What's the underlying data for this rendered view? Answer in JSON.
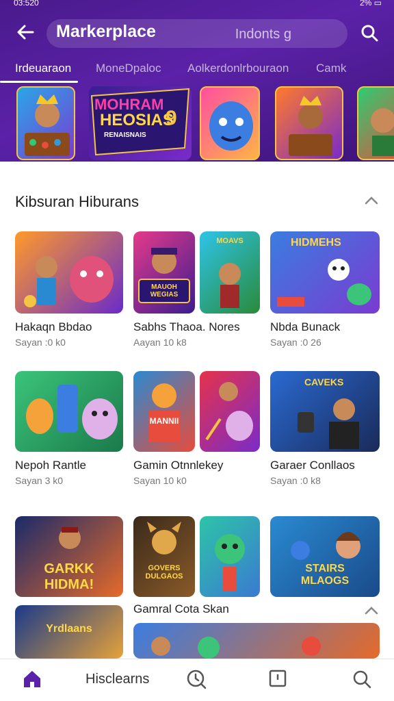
{
  "status_bar": {
    "time": "03:520",
    "battery": "2%"
  },
  "header": {
    "title": "Markerplace",
    "search_text": "Indonts g"
  },
  "tabs": [
    {
      "label": "Irdeuaraon"
    },
    {
      "label": "MoneDpaloc"
    },
    {
      "label": "Aolkerdonlrbouraon"
    },
    {
      "label": "Camk"
    }
  ],
  "banner": {
    "text_line1": "MOHRAM",
    "text_line2": "HEOSIAS",
    "text_line3": "RENAISNAIS",
    "badge": "9"
  },
  "section": {
    "title": "Kibsuran Hiburans"
  },
  "cards": [
    {
      "name": "Hakaqn Bbdao",
      "sub": "Sayan :0 k0"
    },
    {
      "name": "Sabhs Thaoa. Nores",
      "sub": "Aayan 10 k8"
    },
    {
      "name": "Nbda Bunack",
      "sub": "Sayan :0 26"
    },
    {
      "name": "Nepoh Rantle",
      "sub": "Sayan 3 k0"
    },
    {
      "name": "Gamin Otnnlekey",
      "sub": "Sayan 10 k0"
    },
    {
      "name": "Garaer Conllaos",
      "sub": "Sayan :0 k8"
    }
  ],
  "art_text": {
    "t2": "MAUOH WEGIAS",
    "t2b": "MOAVS",
    "t3": "HIDMEHS",
    "t5": "MANNII",
    "t6": "CAVEKS",
    "t7": "GARKK HIDMA!",
    "t8": "GOVERS DULGAOS",
    "t9": "STAIRS MLAOGS",
    "t10": "Yrdlaans"
  },
  "section2": {
    "label": "Gamral Cota Skan"
  },
  "bottom_nav": {
    "label": "Hisclearns"
  }
}
